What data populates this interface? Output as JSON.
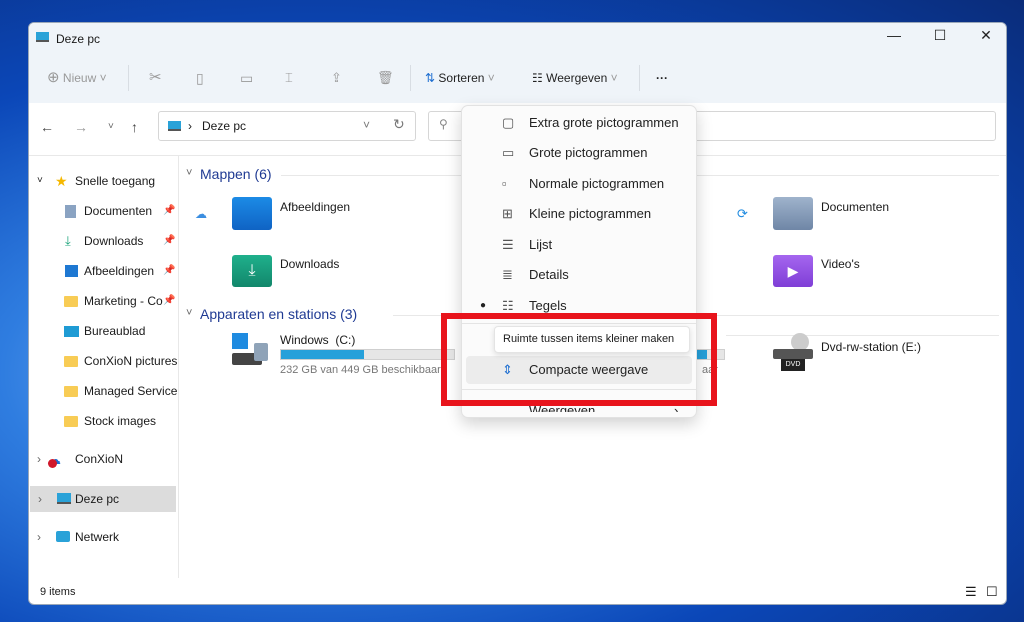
{
  "window": {
    "title": "Deze pc",
    "controls": {
      "minimize": "—",
      "maximize": "☐",
      "close": "✕"
    }
  },
  "toolbar": {
    "new_label": "Nieuw",
    "sort_label": "Sorteren",
    "view_label": "Weergeven",
    "more_label": "···"
  },
  "address": {
    "location": "Deze pc",
    "separator": "›"
  },
  "sidebar": {
    "quick_access": "Snelle toegang",
    "quick_items": [
      {
        "label": "Documenten",
        "pinned": true
      },
      {
        "label": "Downloads",
        "pinned": true
      },
      {
        "label": "Afbeeldingen",
        "pinned": true
      },
      {
        "label": "Marketing - Co",
        "pinned": true
      },
      {
        "label": "Bureaublad"
      },
      {
        "label": "ConXioN pictures"
      },
      {
        "label": "Managed Services-"
      },
      {
        "label": "Stock images"
      }
    ],
    "onedrive": "ConXioN",
    "this_pc": "Deze pc",
    "network": "Netwerk"
  },
  "content": {
    "folders_header": "Mappen (6)",
    "folders": [
      {
        "name": "Afbeeldingen"
      },
      {
        "name": "Downloads"
      },
      {
        "name": "Documenten"
      },
      {
        "name": "Video's"
      }
    ],
    "drives_header": "Apparaten en stations (3)",
    "drives": [
      {
        "name": "Windows  (C:)",
        "free": "232 GB van 449 GB beschikbaar",
        "used_percent": 48
      },
      {
        "name": "Dvd-rw-station (E:)"
      }
    ],
    "partial_text": "aar"
  },
  "menu": {
    "items": [
      {
        "label": "Extra grote pictogrammen",
        "icon": "monitor-icon"
      },
      {
        "label": "Grote pictogrammen",
        "icon": "monitor-icon"
      },
      {
        "label": "Normale pictogrammen",
        "icon": "monitor-icon"
      },
      {
        "label": "Kleine pictogrammen",
        "icon": "grid-icon"
      },
      {
        "label": "Lijst",
        "icon": "list-icon"
      },
      {
        "label": "Details",
        "icon": "details-icon"
      },
      {
        "label": "Tegels",
        "icon": "tiles-icon",
        "selected": true
      }
    ],
    "compact": "Compacte weergave",
    "show": "Weergeven",
    "tooltip": "Ruimte tussen items kleiner maken"
  },
  "status": {
    "count": "9 items"
  },
  "colors": {
    "accent": "#26a0da",
    "highlight": "#e8141c"
  }
}
